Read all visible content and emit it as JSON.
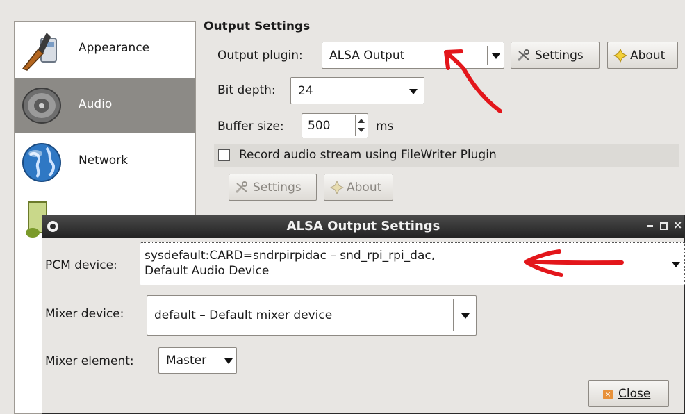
{
  "sidebar": {
    "items": [
      {
        "label": "Appearance",
        "icon": "paintbrush-icon"
      },
      {
        "label": "Audio",
        "icon": "speaker-icon"
      },
      {
        "label": "Network",
        "icon": "globe-icon"
      }
    ]
  },
  "output": {
    "section_title": "Output Settings",
    "plugin_label": "Output plugin:",
    "plugin_value": "ALSA Output",
    "settings_label": "Settings",
    "about_label": "About",
    "bit_depth_label": "Bit depth:",
    "bit_depth_value": "24",
    "buffer_label": "Buffer size:",
    "buffer_value": "500",
    "buffer_unit": "ms",
    "record_label": "Record audio stream using FileWriter Plugin",
    "record_checked": false,
    "fw_settings_label": "Settings",
    "fw_about_label": "About"
  },
  "alsa": {
    "title": "ALSA Output Settings",
    "pcm_label": "PCM device:",
    "pcm_value_line1": "sysdefault:CARD=sndrpirpidac – snd_rpi_rpi_dac,",
    "pcm_value_line2": "Default Audio Device",
    "mixer_device_label": "Mixer device:",
    "mixer_device_value": "default – Default mixer device",
    "mixer_element_label": "Mixer element:",
    "mixer_element_value": "Master",
    "close_label": "Close"
  },
  "colors": {
    "annotation": "#e3161b",
    "active_sidebar": "#8c8a86",
    "titlebar": "#2b2b2b"
  }
}
